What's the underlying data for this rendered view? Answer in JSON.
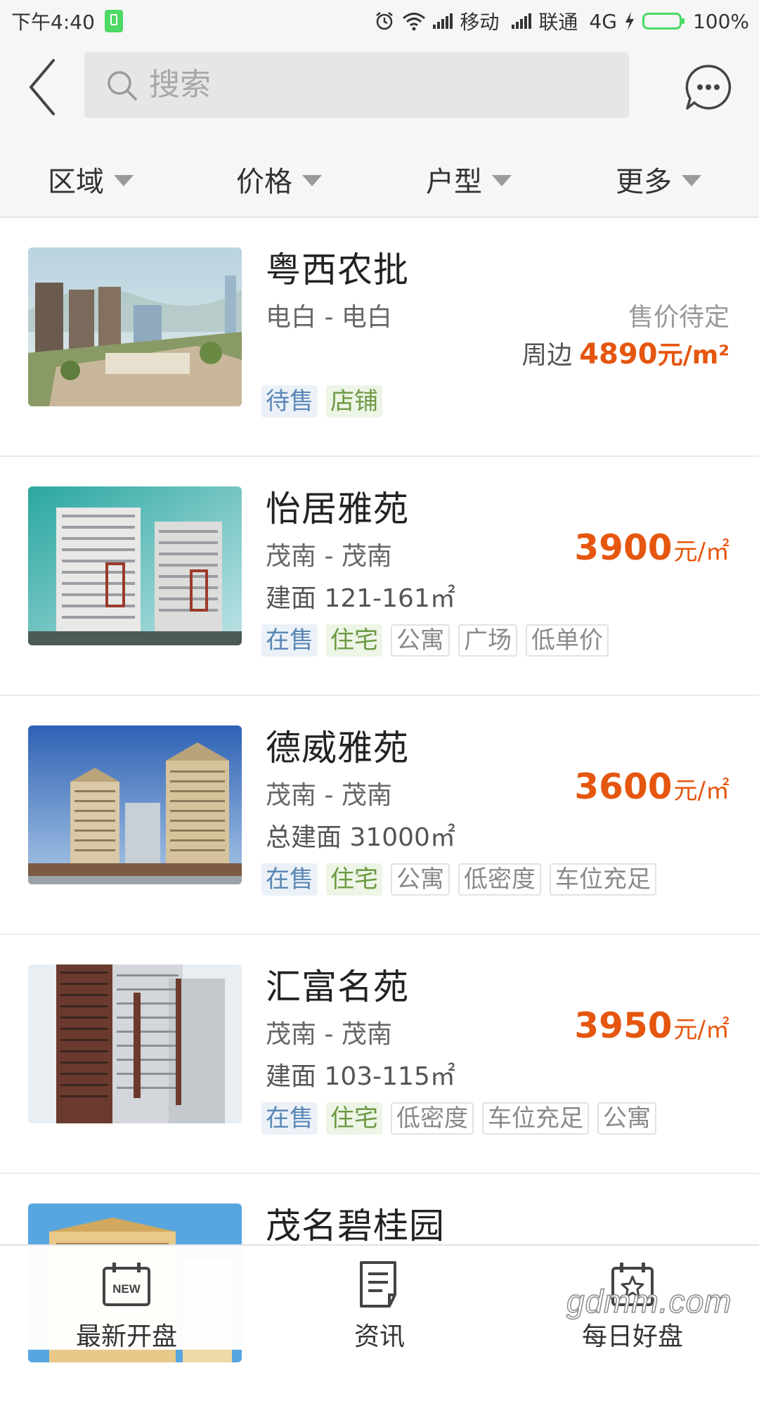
{
  "status_bar": {
    "time": "下午4:40",
    "carrier1": "移动",
    "carrier2": "联通",
    "network": "4G",
    "battery": "100%"
  },
  "header": {
    "search_placeholder": "搜索"
  },
  "filters": [
    "区域",
    "价格",
    "户型",
    "更多"
  ],
  "listings": [
    {
      "name": "粤西农批",
      "location": "电白 - 电白",
      "status_text": "售价待定",
      "price_prefix": "周边",
      "price": "4890",
      "unit": "元/m²",
      "area": "",
      "tags": [
        {
          "text": "待售",
          "style": "blue"
        },
        {
          "text": "店铺",
          "style": "green"
        }
      ]
    },
    {
      "name": "怡居雅苑",
      "location": "茂南 - 茂南",
      "price": "3900",
      "unit": "元/㎡",
      "area": "建面 121-161㎡",
      "tags": [
        {
          "text": "在售",
          "style": "blue"
        },
        {
          "text": "住宅",
          "style": "green"
        },
        {
          "text": "公寓",
          "style": "plain"
        },
        {
          "text": "广场",
          "style": "plain"
        },
        {
          "text": "低单价",
          "style": "plain"
        }
      ]
    },
    {
      "name": "德威雅苑",
      "location": "茂南 - 茂南",
      "price": "3600",
      "unit": "元/㎡",
      "area": "总建面 31000㎡",
      "tags": [
        {
          "text": "在售",
          "style": "blue"
        },
        {
          "text": "住宅",
          "style": "green"
        },
        {
          "text": "公寓",
          "style": "plain"
        },
        {
          "text": "低密度",
          "style": "plain"
        },
        {
          "text": "车位充足",
          "style": "plain"
        }
      ]
    },
    {
      "name": "汇富名苑",
      "location": "茂南 - 茂南",
      "price": "3950",
      "unit": "元/㎡",
      "area": "建面 103-115㎡",
      "tags": [
        {
          "text": "在售",
          "style": "blue"
        },
        {
          "text": "住宅",
          "style": "green"
        },
        {
          "text": "低密度",
          "style": "plain"
        },
        {
          "text": "车位充足",
          "style": "plain"
        },
        {
          "text": "公寓",
          "style": "plain"
        }
      ]
    },
    {
      "name": "茂名碧桂园"
    }
  ],
  "bottom_nav": [
    {
      "label": "最新开盘",
      "icon": "calendar-new-icon",
      "badge": "NEW"
    },
    {
      "label": "资讯",
      "icon": "news-document-icon"
    },
    {
      "label": "每日好盘",
      "icon": "calendar-star-icon"
    }
  ],
  "watermark": "gdmm.com",
  "colors": {
    "price": "#e5560f",
    "tag_blue_text": "#5b87b6",
    "tag_blue_bg": "#ebf1f7",
    "tag_green_text": "#6d9a44",
    "tag_green_bg": "#edf5e6",
    "battery": "#4cd964"
  }
}
